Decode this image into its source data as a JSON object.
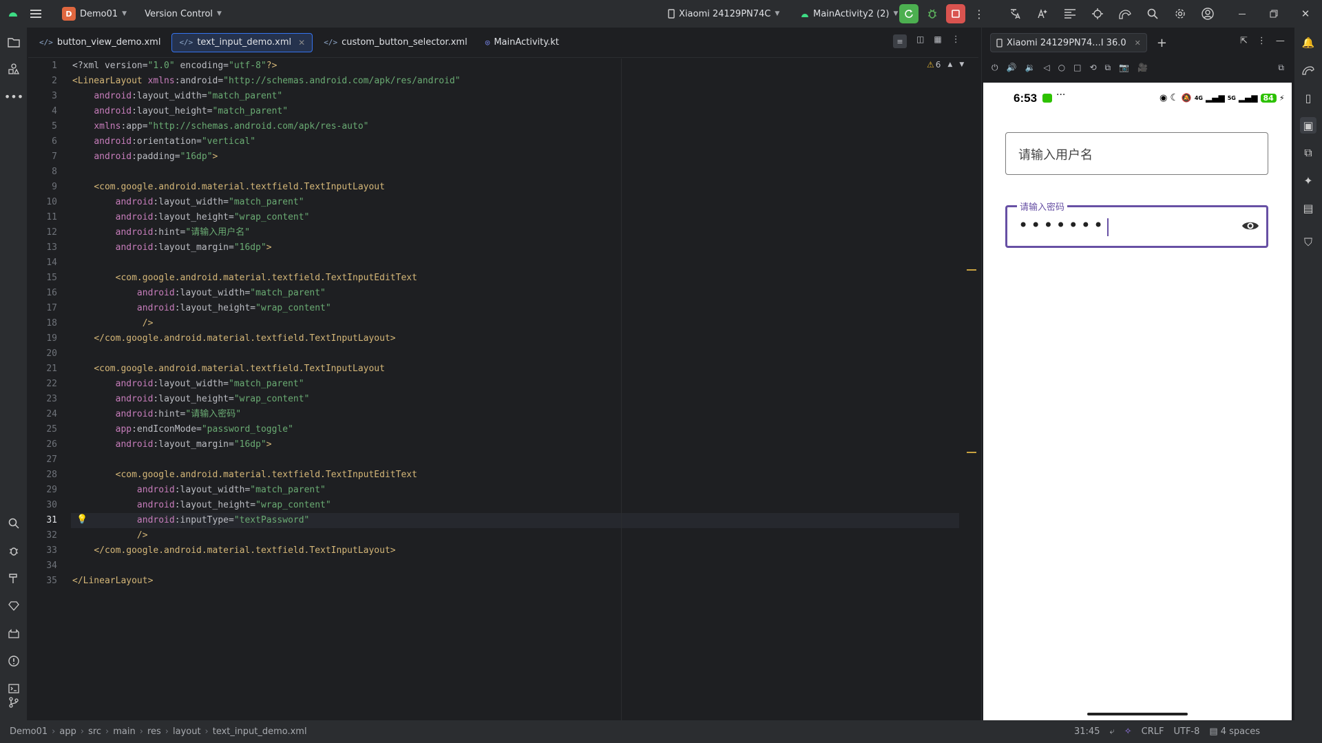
{
  "titlebar": {
    "project_badge": "D",
    "project_name": "Demo01",
    "vcs": "Version Control",
    "device": "Xiaomi 24129PN74C",
    "run_config": "MainActivity2 (2)"
  },
  "editor": {
    "tabs": [
      {
        "label": "button_view_demo.xml",
        "icon": "xml-icon"
      },
      {
        "label": "text_input_demo.xml",
        "icon": "xml-icon",
        "active": true
      },
      {
        "label": "custom_button_selector.xml",
        "icon": "xml-icon"
      },
      {
        "label": "MainActivity.kt",
        "icon": "kotlin-icon"
      }
    ],
    "warning_count": "6",
    "line_numbers": [
      "1",
      "2",
      "3",
      "4",
      "5",
      "6",
      "7",
      "8",
      "9",
      "10",
      "11",
      "12",
      "13",
      "14",
      "15",
      "16",
      "17",
      "18",
      "19",
      "20",
      "21",
      "22",
      "23",
      "24",
      "25",
      "26",
      "27",
      "28",
      "29",
      "30",
      "31",
      "32",
      "33",
      "34",
      "35"
    ],
    "current_line": "31",
    "code": [
      "<?xml version=\"1.0\" encoding=\"utf-8\"?>",
      "<LinearLayout xmlns:android=\"http://schemas.android.com/apk/res/android\"",
      "    android:layout_width=\"match_parent\"",
      "    android:layout_height=\"match_parent\"",
      "    xmlns:app=\"http://schemas.android.com/apk/res-auto\"",
      "    android:orientation=\"vertical\"",
      "    android:padding=\"16dp\">",
      "",
      "    <com.google.android.material.textfield.TextInputLayout",
      "        android:layout_width=\"match_parent\"",
      "        android:layout_height=\"wrap_content\"",
      "        android:hint=\"请输入用户名\"",
      "        android:layout_margin=\"16dp\">",
      "",
      "        <com.google.android.material.textfield.TextInputEditText",
      "            android:layout_width=\"match_parent\"",
      "            android:layout_height=\"wrap_content\"",
      "             />",
      "    </com.google.android.material.textfield.TextInputLayout>",
      "",
      "    <com.google.android.material.textfield.TextInputLayout",
      "        android:layout_width=\"match_parent\"",
      "        android:layout_height=\"wrap_content\"",
      "        android:hint=\"请输入密码\"",
      "        app:endIconMode=\"password_toggle\"",
      "        android:layout_margin=\"16dp\">",
      "",
      "        <com.google.android.material.textfield.TextInputEditText",
      "            android:layout_width=\"match_parent\"",
      "            android:layout_height=\"wrap_content\"",
      "            android:inputType=\"textPassword\"",
      "            />",
      "    </com.google.android.material.textfield.TextInputLayout>",
      "",
      "</LinearLayout>"
    ]
  },
  "device_panel": {
    "tab_label": "Xiaomi 24129PN74...I 36.0",
    "phone": {
      "time": "6:53",
      "network": "4G",
      "network2": "5G",
      "battery": "84",
      "username_hint": "请输入用户名",
      "password_label": "请输入密码",
      "password_value": "•••••••"
    }
  },
  "statusbar": {
    "breadcrumbs": [
      "Demo01",
      "app",
      "src",
      "main",
      "res",
      "layout",
      "text_input_demo.xml"
    ],
    "position": "31:45",
    "line_sep": "CRLF",
    "encoding": "UTF-8",
    "indent": "4 spaces"
  },
  "colors": {
    "accent": "#3574f0",
    "tag": "#d5b778",
    "string": "#6aab73",
    "namespace": "#c77dbb",
    "material_primary": "#6750a4",
    "run_green": "#4caf50",
    "stop_red": "#d9534f"
  }
}
